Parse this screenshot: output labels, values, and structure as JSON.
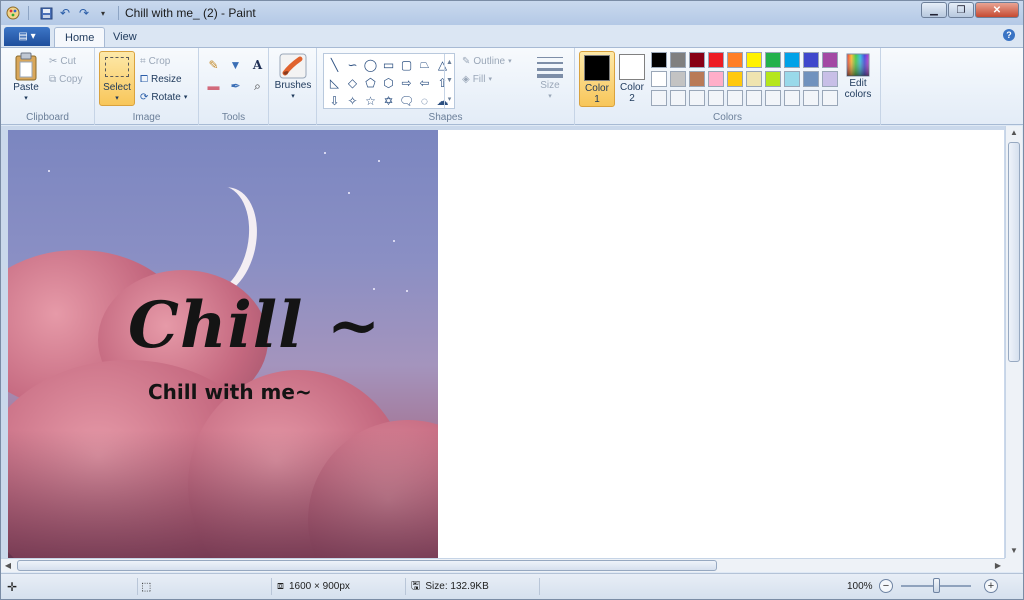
{
  "window": {
    "title": "Chill with me_ (2) - Paint",
    "minimize_icon": "minimize-icon",
    "maximize_icon": "restore-icon",
    "close_icon": "close-icon"
  },
  "quick_access": [
    {
      "name": "paint-app-icon"
    },
    {
      "name": "save-icon"
    },
    {
      "name": "undo-icon"
    },
    {
      "name": "redo-icon"
    },
    {
      "name": "customize-dropdown-icon"
    }
  ],
  "tabs": [
    {
      "label": "Home",
      "active": true
    },
    {
      "label": "View",
      "active": false
    }
  ],
  "ribbon": {
    "clipboard": {
      "label": "Clipboard",
      "paste": "Paste",
      "cut": "Cut",
      "copy": "Copy"
    },
    "image": {
      "label": "Image",
      "select": "Select",
      "crop": "Crop",
      "resize": "Resize",
      "rotate": "Rotate"
    },
    "tools": {
      "label": "Tools"
    },
    "brushes": {
      "label": "Brushes"
    },
    "shapes": {
      "label": "Shapes",
      "outline": "Outline",
      "fill": "Fill"
    },
    "size": {
      "label": "Size"
    },
    "colors": {
      "label": "Colors",
      "color1": "Color",
      "color1_num": "1",
      "color2": "Color",
      "color2_num": "2",
      "edit_colors": "Edit colors",
      "color1_value": "#000000",
      "color2_value": "#ffffff",
      "palette_row1": [
        "#000000",
        "#7f7f7f",
        "#880015",
        "#ed1c24",
        "#ff7f27",
        "#fff200",
        "#22b14c",
        "#00a2e8",
        "#3f48cc",
        "#a349a4"
      ],
      "palette_row2": [
        "#ffffff",
        "#c3c3c3",
        "#b97a57",
        "#ffaec9",
        "#ffc90e",
        "#efe4b0",
        "#b5e61d",
        "#99d9ea",
        "#7092be",
        "#c8bfe7"
      ]
    }
  },
  "artwork": {
    "title_text": "Chill ~",
    "subtitle_text": "Chill with me~"
  },
  "statusbar": {
    "dimensions": "1600 × 900px",
    "size": "Size: 132.9KB",
    "zoom": "100%"
  }
}
